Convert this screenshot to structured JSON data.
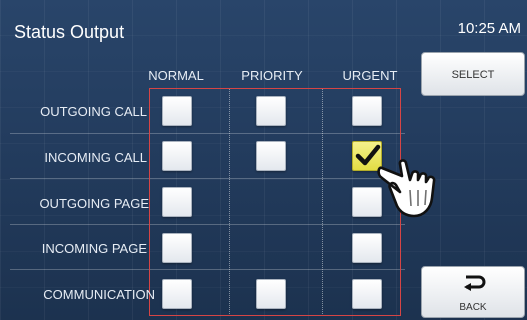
{
  "header": {
    "title": "Status Output",
    "time": "10:25 AM"
  },
  "columns": [
    "NORMAL",
    "PRIORITY",
    "URGENT"
  ],
  "rows": [
    {
      "label": "OUTGOING CALL",
      "checks": [
        false,
        false,
        false
      ],
      "visible": [
        true,
        true,
        true
      ]
    },
    {
      "label": "INCOMING CALL",
      "checks": [
        false,
        false,
        true
      ],
      "visible": [
        true,
        true,
        true
      ]
    },
    {
      "label": "OUTGOING PAGE",
      "checks": [
        false,
        false,
        false
      ],
      "visible": [
        true,
        false,
        true
      ]
    },
    {
      "label": "INCOMING PAGE",
      "checks": [
        false,
        false,
        false
      ],
      "visible": [
        true,
        false,
        true
      ]
    },
    {
      "label": "COMMUNICATION",
      "checks": [
        false,
        false,
        false
      ],
      "visible": [
        true,
        true,
        true
      ]
    }
  ],
  "buttons": {
    "select": "SELECT",
    "back": "BACK"
  },
  "colors": {
    "checked": "#e2dc44",
    "frame": "#d64545"
  },
  "icons": {
    "back": "back-arrow-icon",
    "pointer": "hand-pointer-icon",
    "check": "checkmark-icon"
  }
}
